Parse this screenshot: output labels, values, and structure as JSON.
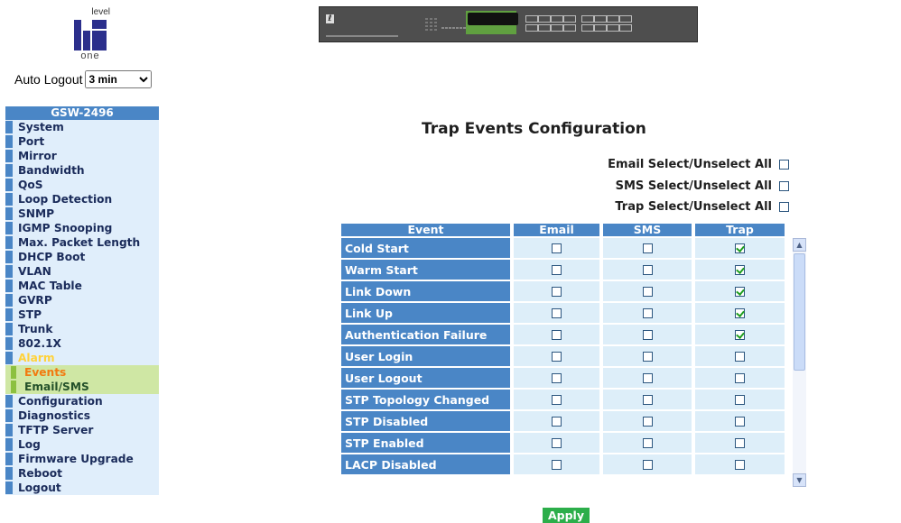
{
  "logo": {
    "top_text": "level",
    "bottom_text": "one"
  },
  "auto_logout": {
    "label": "Auto Logout",
    "value": "3 min"
  },
  "sidebar": {
    "title": "GSW-2496",
    "items": [
      "System",
      "Port",
      "Mirror",
      "Bandwidth",
      "QoS",
      "Loop Detection",
      "SNMP",
      "IGMP Snooping",
      "Max. Packet Length",
      "DHCP Boot",
      "VLAN",
      "MAC Table",
      "GVRP",
      "STP",
      "Trunk",
      "802.1X",
      "Alarm"
    ],
    "subitems": [
      "Events",
      "Email/SMS"
    ],
    "items_after": [
      "Configuration",
      "Diagnostics",
      "TFTP Server",
      "Log",
      "Firmware Upgrade",
      "Reboot",
      "Logout"
    ]
  },
  "page_title": "Trap Events Configuration",
  "select_all": {
    "email": "Email Select/Unselect All",
    "sms": "SMS Select/Unselect All",
    "trap": "Trap Select/Unselect All"
  },
  "table": {
    "headers": [
      "Event",
      "Email",
      "SMS",
      "Trap"
    ],
    "rows": [
      {
        "event": "Cold Start",
        "email": false,
        "sms": false,
        "trap": true
      },
      {
        "event": "Warm Start",
        "email": false,
        "sms": false,
        "trap": true
      },
      {
        "event": "Link Down",
        "email": false,
        "sms": false,
        "trap": true
      },
      {
        "event": "Link Up",
        "email": false,
        "sms": false,
        "trap": true
      },
      {
        "event": "Authentication Failure",
        "email": false,
        "sms": false,
        "trap": true
      },
      {
        "event": "User Login",
        "email": false,
        "sms": false,
        "trap": false
      },
      {
        "event": "User Logout",
        "email": false,
        "sms": false,
        "trap": false
      },
      {
        "event": "STP Topology Changed",
        "email": false,
        "sms": false,
        "trap": false
      },
      {
        "event": "STP Disabled",
        "email": false,
        "sms": false,
        "trap": false
      },
      {
        "event": "STP Enabled",
        "email": false,
        "sms": false,
        "trap": false
      },
      {
        "event": "LACP Disabled",
        "email": false,
        "sms": false,
        "trap": false
      }
    ]
  },
  "apply_label": "Apply",
  "colors": {
    "sidebar_accent": "#4a86c6",
    "row_bg": "#ddeef9",
    "apply_bg": "#2cae4a",
    "active_sub": "#f27a10",
    "alarm": "#ffd23a"
  },
  "icons": {
    "scroll_up": "triangle-up-icon",
    "scroll_down": "triangle-down-icon"
  }
}
